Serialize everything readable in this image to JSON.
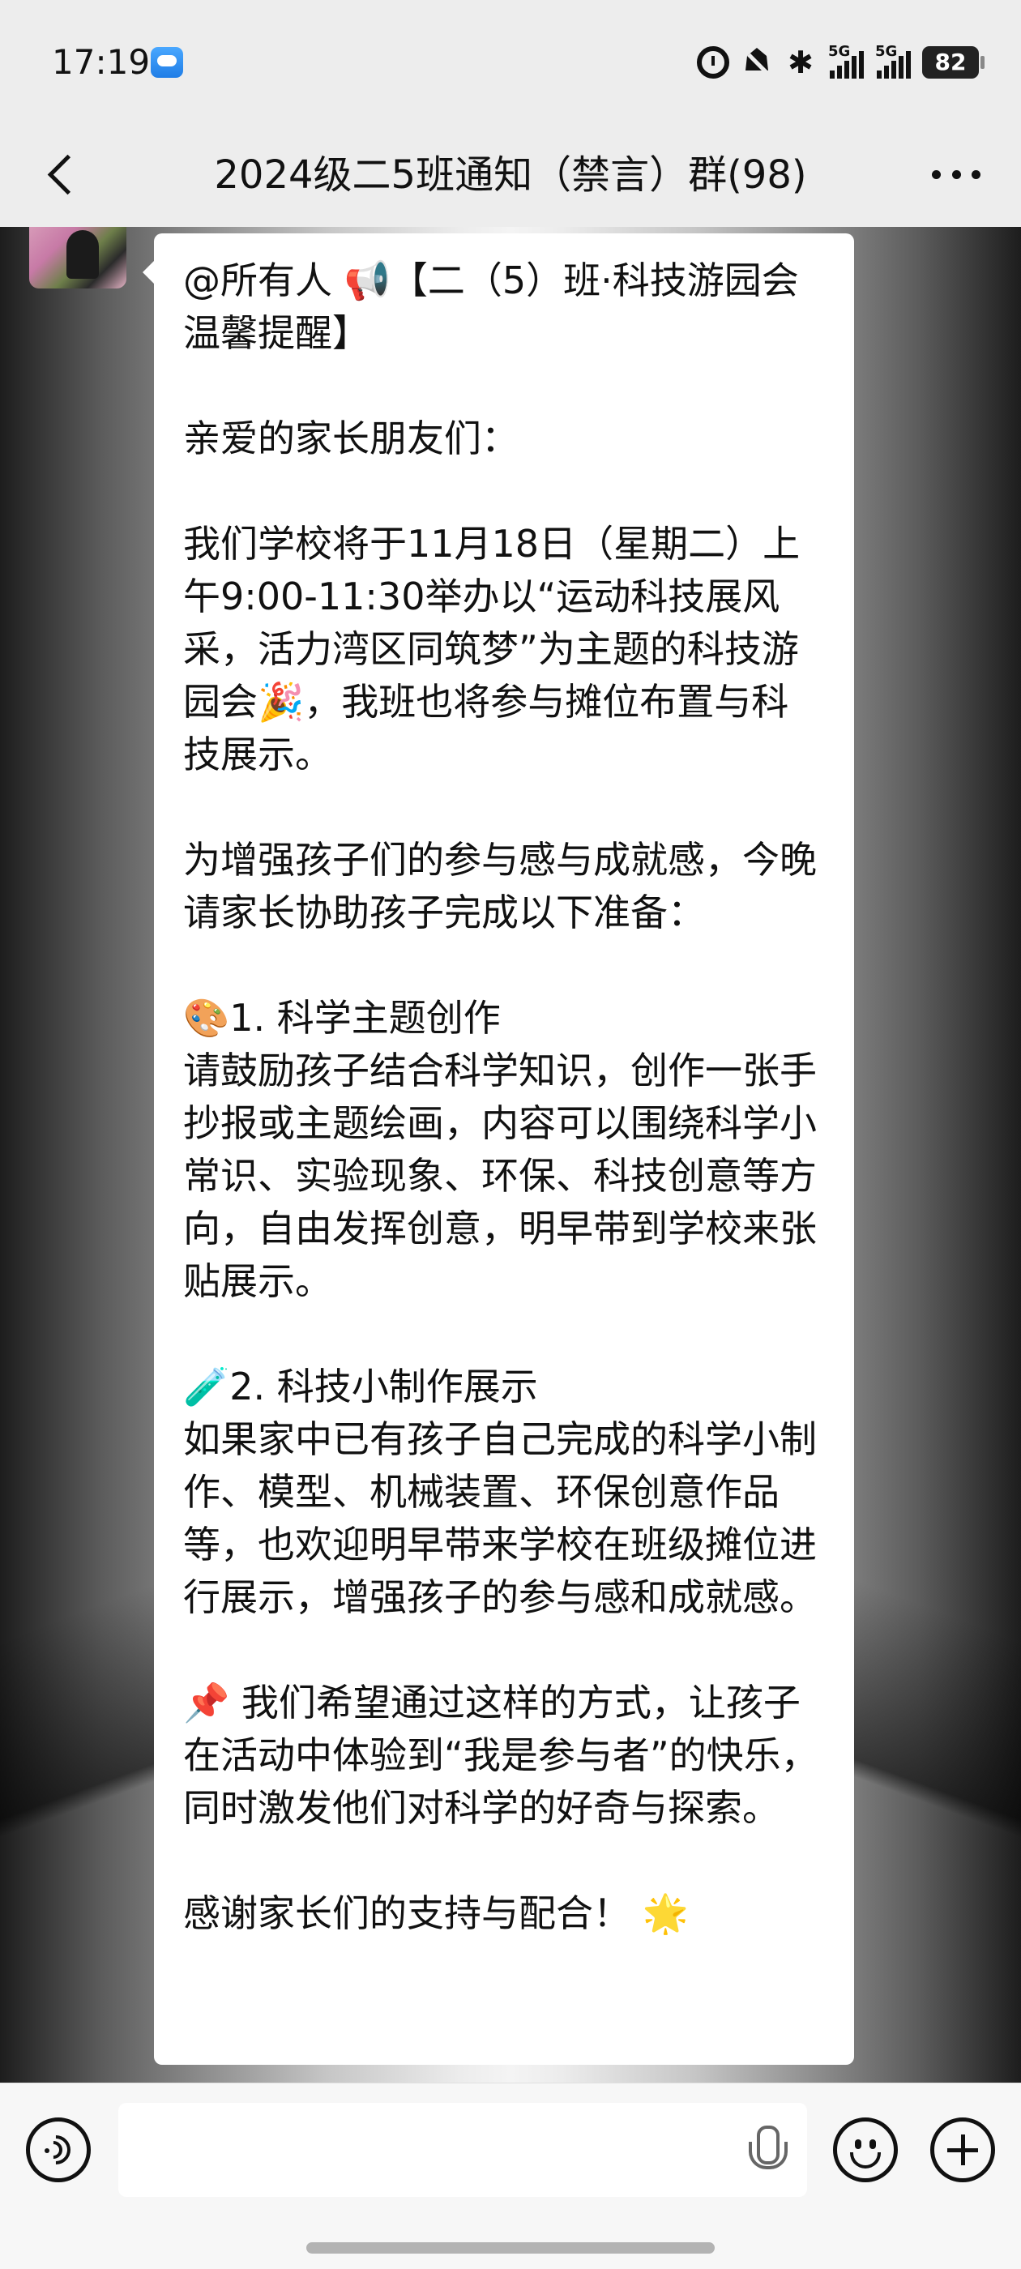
{
  "status_bar": {
    "time": "17:19",
    "network1": "5G",
    "network2": "5G",
    "battery": "82"
  },
  "header": {
    "title": "2024级二5班通知（禁言）群(98)"
  },
  "message": {
    "text": "@所有人 📢【二（5）班·科技游园会温馨提醒】\n\n亲爱的家长朋友们：\n\n我们学校将于11月18日（星期二）上午9:00-11:30举办以“运动科技展风采，活力湾区同筑梦”为主题的科技游园会🎉，我班也将参与摊位布置与科技展示。\n\n为增强孩子们的参与感与成就感，今晚请家长协助孩子完成以下准备：\n\n🎨1. 科学主题创作\n请鼓励孩子结合科学知识，创作一张手抄报或主题绘画，内容可以围绕科学小常识、实验现象、环保、科技创意等方向，自由发挥创意，明早带到学校来张贴展示。\n\n🧪2. 科技小制作展示\n如果家中已有孩子自己完成的科学小制作、模型、机械装置、环保创意作品等，也欢迎明早带来学校在班级摊位进行展示，增强孩子的参与感和成就感。\n\n📌 我们希望通过这样的方式，让孩子在活动中体验到“我是参与者”的快乐，同时激发他们对科学的好奇与探索。\n\n感谢家长们的支持与配合！ 🌟"
  },
  "icons": {
    "back": "chevron-left-icon",
    "more": "more-dots-icon",
    "voice": "voice-icon",
    "mic": "microphone-icon",
    "emoji": "emoji-icon",
    "plus": "plus-icon"
  }
}
